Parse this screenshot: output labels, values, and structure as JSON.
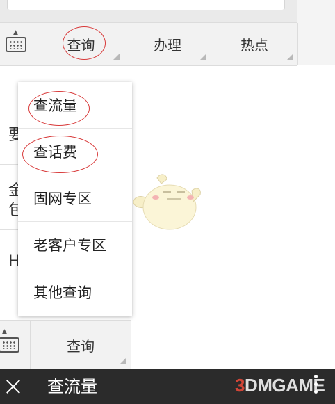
{
  "menubar": {
    "tabs": [
      {
        "label": "查询"
      },
      {
        "label": "办理"
      },
      {
        "label": "热点"
      }
    ]
  },
  "dropdown": {
    "items": [
      {
        "label": "查流量"
      },
      {
        "label": "查话费"
      },
      {
        "label": "固网专区"
      },
      {
        "label": "老客户专区"
      },
      {
        "label": "其他查询"
      }
    ]
  },
  "background_chars": [
    "要",
    "金",
    "包",
    "H"
  ],
  "bottom_bar": {
    "tab_label": "查询"
  },
  "titlebar": {
    "title": "查流量"
  },
  "watermark": {
    "prefix": "3",
    "text": "DMGAME"
  },
  "colors": {
    "annotation": "#d83a3a",
    "titlebar": "#2b2b2b",
    "menubar": "#f2f2f2"
  }
}
